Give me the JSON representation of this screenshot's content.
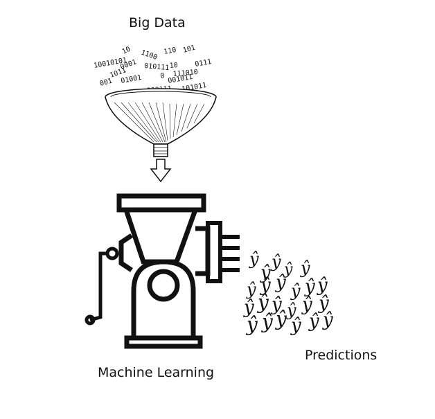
{
  "labels": {
    "input": "Big Data",
    "process": "Machine Learning",
    "output": "Predictions"
  },
  "binary_stream": [
    "10",
    "1100",
    "110",
    "101",
    "10010101",
    "0001",
    "010111",
    "10",
    "0111",
    "1011",
    "0",
    "111010",
    "001",
    "01001",
    "001011",
    "000111",
    "101011"
  ],
  "prediction_symbol": "ŷ",
  "colors": {
    "ink": "#111111",
    "background": "#ffffff"
  }
}
